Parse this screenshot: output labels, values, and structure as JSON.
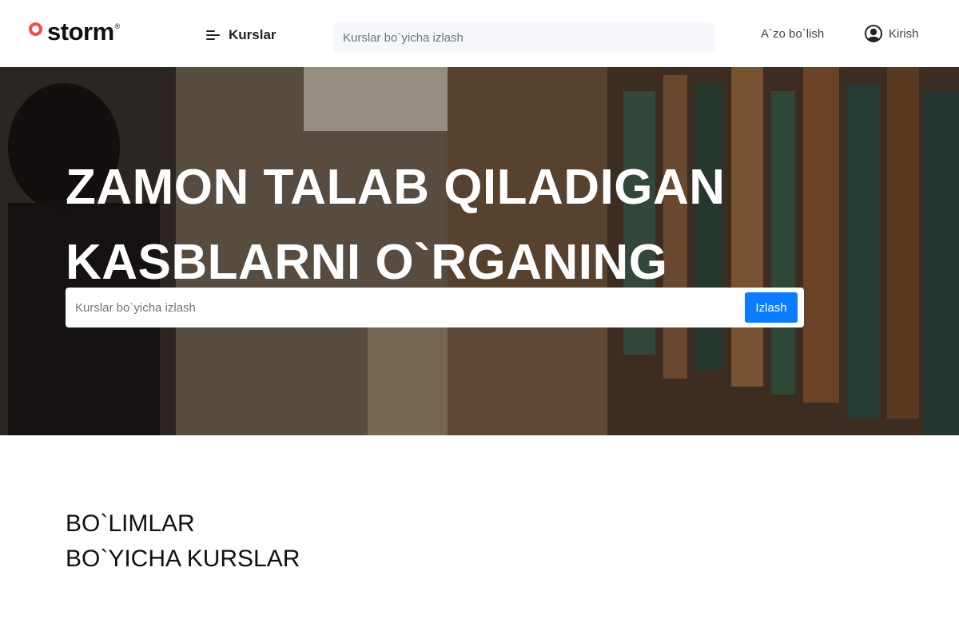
{
  "header": {
    "logo_text": "storm",
    "logo_reg": "®",
    "nav_courses_label": "Kurslar",
    "search_placeholder": "Kurslar bo`yicha izlash",
    "signup_label": "A`zo bo`lish",
    "login_label": "Kirish"
  },
  "hero": {
    "title_line1": "ZAMON TALAB QILADIGAN",
    "title_line2": "KASBLARNI O`RGANING",
    "search_placeholder": "Kurslar bo`yicha izlash",
    "search_button": "Izlash"
  },
  "sections": {
    "title_line1": "BO`LIMLAR",
    "title_line2": "BO`YICHA KURSLAR"
  },
  "colors": {
    "brand": "#f04e4e",
    "primary_button": "#0a7cff"
  }
}
